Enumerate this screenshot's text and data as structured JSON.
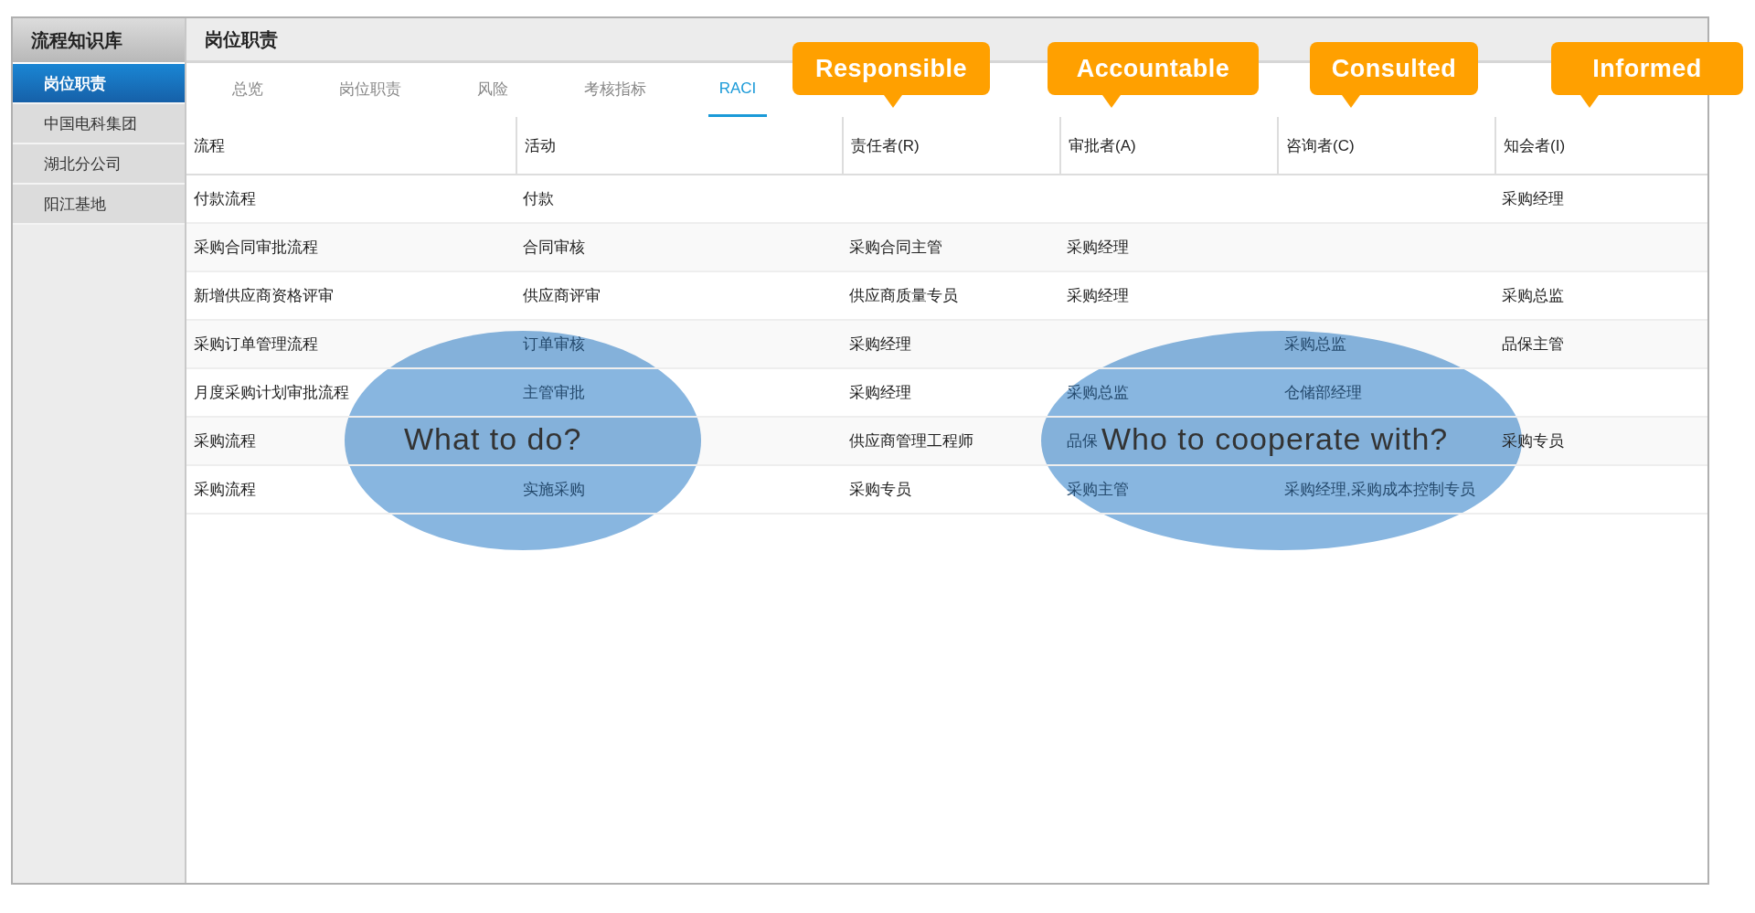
{
  "sidebar": {
    "title": "流程知识库",
    "items": [
      {
        "label": "岗位职责",
        "selected": true
      },
      {
        "label": "中国电科集团",
        "selected": false
      },
      {
        "label": "湖北分公司",
        "selected": false
      },
      {
        "label": "阳江基地",
        "selected": false
      }
    ]
  },
  "page_title": "岗位职责",
  "tabs": [
    {
      "label": "总览",
      "selected": false
    },
    {
      "label": "岗位职责",
      "selected": false
    },
    {
      "label": "风险",
      "selected": false
    },
    {
      "label": "考核指标",
      "selected": false
    },
    {
      "label": "RACI",
      "selected": true
    }
  ],
  "table": {
    "columns": [
      "流程",
      "活动",
      "责任者(R)",
      "审批者(A)",
      "咨询者(C)",
      "知会者(I)"
    ],
    "rows": [
      [
        "付款流程",
        "付款",
        "",
        "",
        "",
        "采购经理"
      ],
      [
        "采购合同审批流程",
        "合同审核",
        "采购合同主管",
        "采购经理",
        "",
        ""
      ],
      [
        "新增供应商资格评审",
        "供应商评审",
        "供应商质量专员",
        "采购经理",
        "",
        "采购总监"
      ],
      [
        "采购订单管理流程",
        "订单审核",
        "采购经理",
        "",
        "采购总监",
        "品保主管"
      ],
      [
        "月度采购计划审批流程",
        "主管审批",
        "采购经理",
        "采购总监",
        "仓储部经理",
        ""
      ],
      [
        "采购流程",
        "",
        "供应商管理工程师",
        "品保",
        "",
        "采购专员"
      ],
      [
        "采购流程",
        "实施采购",
        "采购专员",
        "采购主管",
        "采购经理,采购成本控制专员",
        ""
      ]
    ]
  },
  "callouts": [
    "Responsible",
    "Accountable",
    "Consulted",
    "Informed"
  ],
  "overlays": [
    "What to do?",
    "Who to cooperate with?"
  ]
}
